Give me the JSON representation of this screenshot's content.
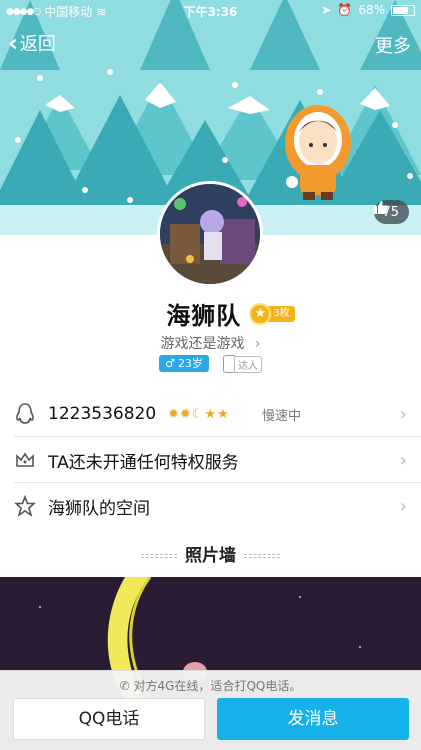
{
  "status_bar": {
    "carrier": "中国移动",
    "time": "下午3:36",
    "battery": "68%"
  },
  "nav": {
    "back_label": "返回",
    "more_label": "更多"
  },
  "likes": {
    "count": "75"
  },
  "profile": {
    "name": "海狮队",
    "medal_count": "3枚",
    "signature": "游戏还是游戏",
    "age": "23岁",
    "device_tag": "达人"
  },
  "rows": {
    "qq_number": "1223536820",
    "speed": "慢速中",
    "privilege": "TA还未开通任何特权服务",
    "space": "海狮队的空间"
  },
  "photo_wall": {
    "title": "照片墙"
  },
  "call_bar": {
    "hint": "对方4G在线，适合打QQ电话。",
    "call_label": "QQ电话",
    "message_label": "发消息"
  },
  "colors": {
    "accent": "#17b1ea",
    "header_sky": "#8fdde0",
    "tree": "#3aaab5",
    "medal": "#f4b31a"
  }
}
